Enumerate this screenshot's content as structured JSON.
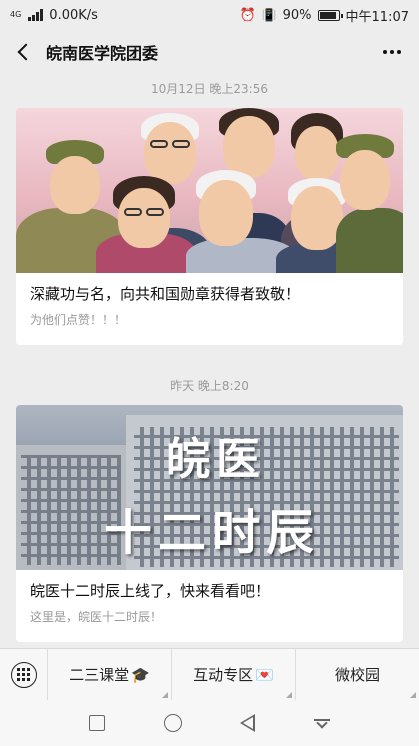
{
  "status_bar": {
    "network_type": "4G",
    "speed": "0.00K/s",
    "battery_percent": "90%",
    "time": "中午11:07",
    "battery_level": 0.9
  },
  "nav": {
    "title": "皖南医学院团委"
  },
  "messages": [
    {
      "timestamp": "10月12日 晚上23:56",
      "title": "深藏功与名，向共和国勋章获得者致敬！",
      "subtitle": "为他们点赞！！！"
    },
    {
      "timestamp": "昨天 晚上8:20",
      "title": "皖医十二时辰上线了，快来看看吧！",
      "subtitle": "这里是，皖医十二时辰！",
      "image_text_line1": "皖医",
      "image_text_line2": "十二时辰"
    }
  ],
  "menu": {
    "items": [
      {
        "label": "二三课堂",
        "emoji": "🎓"
      },
      {
        "label": "互动专区",
        "emoji": "💌"
      },
      {
        "label": "微校园",
        "emoji": ""
      }
    ]
  },
  "colors": {
    "background": "#ededed",
    "card": "#ffffff",
    "timestamp_text": "#9a9a9a"
  },
  "icons": {
    "back": "back-arrow-icon",
    "more": "more-icon",
    "keyboard": "keyboard-icon",
    "alarm": "alarm-icon",
    "vibrate": "vibrate-icon"
  }
}
